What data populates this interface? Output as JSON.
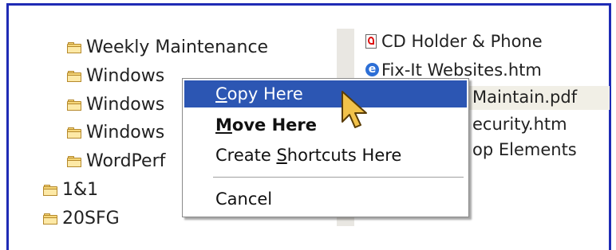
{
  "folders_nested": [
    {
      "label": "Weekly Maintenance"
    },
    {
      "label": "Windows"
    },
    {
      "label": "Windows"
    },
    {
      "label": "Windows"
    },
    {
      "label": "WordPerf"
    }
  ],
  "folders_root": [
    {
      "label": "1&1"
    },
    {
      "label": "20SFG"
    }
  ],
  "files": [
    {
      "label": "CD Holder & Phone",
      "icon": "pdf-icon"
    },
    {
      "label": "Fix-It  Websites.htm",
      "icon": "ie-icon"
    },
    {
      "label": "Maintain.pdf",
      "icon": ""
    },
    {
      "label": "ecurity.htm",
      "icon": ""
    },
    {
      "label": "op Elements",
      "icon": ""
    }
  ],
  "context_menu": {
    "copy_pre": "",
    "copy_key": "C",
    "copy_post": "opy Here",
    "move_pre": "",
    "move_key": "M",
    "move_post": "ove Here",
    "shortcuts_pre": "Create ",
    "shortcuts_key": "S",
    "shortcuts_post": "hortcuts Here",
    "cancel": "Cancel"
  },
  "colors": {
    "highlight": "#2c56b3",
    "frame_border": "#1f2bb5",
    "folder": "#f6d77a"
  }
}
